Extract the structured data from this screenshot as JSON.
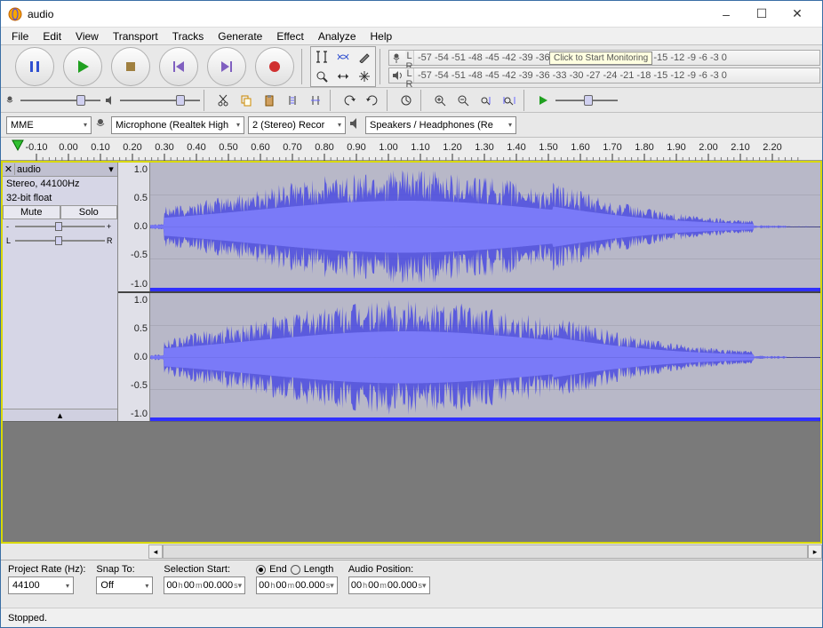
{
  "window": {
    "title": "audio"
  },
  "menu": [
    "File",
    "Edit",
    "View",
    "Transport",
    "Tracks",
    "Generate",
    "Effect",
    "Analyze",
    "Help"
  ],
  "meter": {
    "scale": "-57  -54  -51  -48  -45  -42  -39  -36  -33  -30  -27  -24  -21  -18  -15  -12   -9   -6   -3    0",
    "monitor_tip": "Click to Start Monitoring"
  },
  "devices": {
    "host": "MME",
    "input": "Microphone (Realtek High",
    "channels": "2 (Stereo) Recor",
    "output": "Speakers / Headphones (Re"
  },
  "timeline": {
    "labels": [
      "-0.10",
      "0.00",
      "0.10",
      "0.20",
      "0.30",
      "0.40",
      "0.50",
      "0.60",
      "0.70",
      "0.80",
      "0.90",
      "1.00",
      "1.10",
      "1.20",
      "1.30",
      "1.40",
      "1.50",
      "1.60",
      "1.70",
      "1.80",
      "1.90",
      "2.00",
      "2.10",
      "2.20"
    ]
  },
  "track": {
    "name": "audio",
    "format": "Stereo, 44100Hz",
    "depth": "32-bit float",
    "mute": "Mute",
    "solo": "Solo",
    "vscale": [
      "1.0",
      "0.5",
      "0.0",
      "-0.5",
      "-1.0"
    ]
  },
  "bottom": {
    "project_rate_label": "Project Rate (Hz):",
    "project_rate": "44100",
    "snap_label": "Snap To:",
    "snap": "Off",
    "sel_start_label": "Selection Start:",
    "end_label": "End",
    "length_label": "Length",
    "audio_pos_label": "Audio Position:",
    "time_h": "00",
    "time_m": "00",
    "time_s": "00.000"
  },
  "status": "Stopped."
}
